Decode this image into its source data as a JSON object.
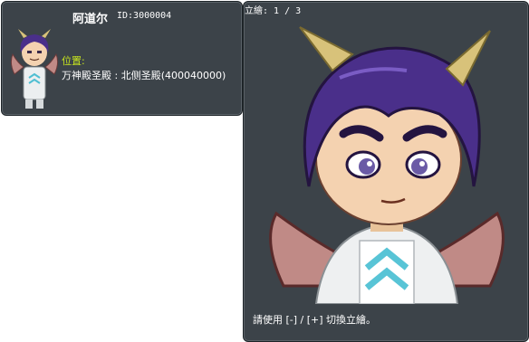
{
  "npc": {
    "name": "阿道尔",
    "id_text": "ID:3000004",
    "location_label": "位置:",
    "location_value": "万神殿圣殿 : 北侧圣殿(400040000)"
  },
  "portrait": {
    "counter": "立繪: 1 / 3",
    "hint": "請使用 [-] / [+] 切換立繪。"
  },
  "colors": {
    "panel_bg": "#3c4349",
    "label_accent": "#c8e61e",
    "hair": "#4a2f8a",
    "horn": "#d8c27a",
    "wing": "#c08a86"
  }
}
